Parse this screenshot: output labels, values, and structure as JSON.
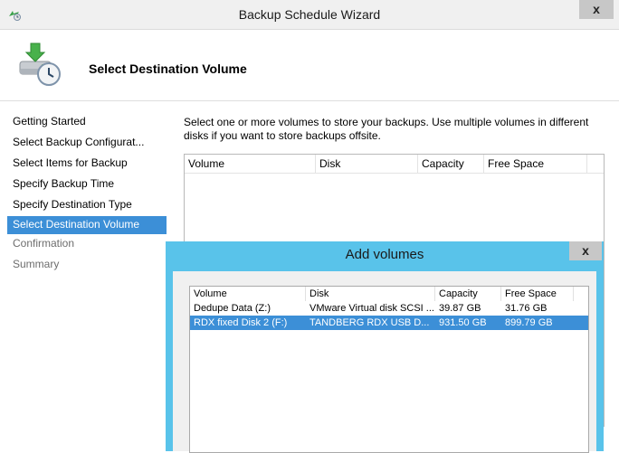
{
  "window": {
    "title": "Backup Schedule Wizard",
    "close_label": "x"
  },
  "header": {
    "title": "Select Destination Volume"
  },
  "nav": {
    "items": [
      {
        "label": "Getting Started"
      },
      {
        "label": "Select Backup Configurat..."
      },
      {
        "label": "Select Items for Backup"
      },
      {
        "label": "Specify Backup Time"
      },
      {
        "label": "Specify Destination Type"
      },
      {
        "label": "Select Destination Volume"
      },
      {
        "label": "Confirmation"
      },
      {
        "label": "Summary"
      }
    ]
  },
  "main": {
    "description": "Select one or more volumes to store your backups. Use multiple volumes in different disks if you want to store backups offsite.",
    "table": {
      "columns": [
        "Volume",
        "Disk",
        "Capacity",
        "Free Space"
      ]
    }
  },
  "dialog": {
    "title": "Add volumes",
    "close_label": "x",
    "columns": [
      "Volume",
      "Disk",
      "Capacity",
      "Free Space"
    ],
    "rows": [
      {
        "volume": "Dedupe Data (Z:)",
        "disk": "VMware Virtual disk SCSI ...",
        "capacity": "39.87 GB",
        "free": "31.76 GB"
      },
      {
        "volume": "RDX fixed Disk 2 (F:)",
        "disk": "TANDBERG RDX USB D...",
        "capacity": "931.50 GB",
        "free": "899.79 GB"
      }
    ]
  },
  "colors": {
    "selection": "#3c8fd7",
    "dialog_frame": "#59c3ea"
  }
}
